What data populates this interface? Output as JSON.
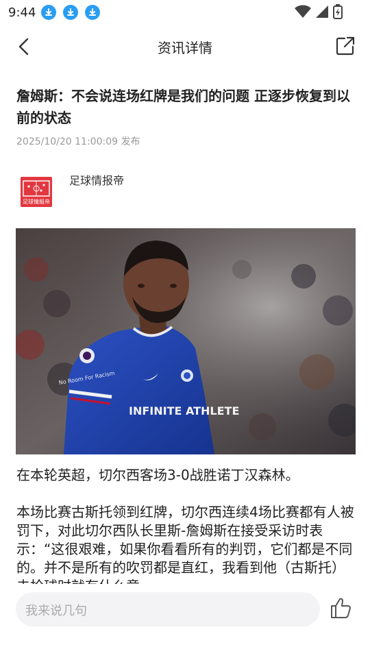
{
  "status_bar": {
    "time": "9:44"
  },
  "header": {
    "title": "资讯详情"
  },
  "article": {
    "title": "詹姆斯：不会说连场红牌是我们的问题 正逐步恢复到以前的状态",
    "publish_time": "2025/10/20 11:00:09 发布",
    "author": {
      "name": "足球情报帝",
      "avatar_text": "足球情报帝"
    },
    "image": {
      "shirt_sponsor": "INFINITE ATHLETE",
      "sleeve_text": "No Room For Racism"
    },
    "paragraphs": [
      "在本轮英超，切尔西客场3-0战胜诺丁汉森林。",
      "本场比赛古斯托领到红牌，切尔西连续4场比赛都有人被罚下，对此切尔西队长里斯-詹姆斯在接受采访时表示：“这很艰难，如果你看看所有的判罚，它们都是不同的。并不是所有的吹罚都是直红，我看到他（古斯托）去抢球时就有什么意"
    ]
  },
  "comment_bar": {
    "placeholder": "我来说几句"
  },
  "colors": {
    "download_icon": "#2a9df4",
    "avatar_bg": "#e2373f",
    "jersey": "#1c3fa3"
  }
}
